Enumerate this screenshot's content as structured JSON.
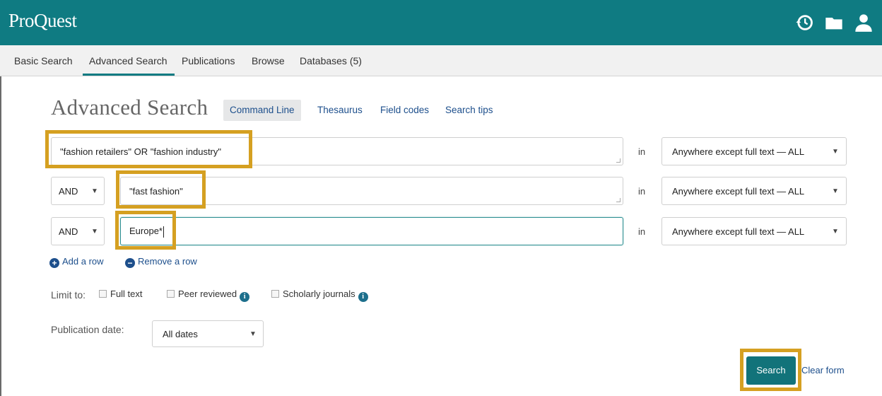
{
  "app": {
    "logo": "ProQuest"
  },
  "header_icons": [
    "history-icon",
    "folder-icon",
    "user-icon"
  ],
  "nav": {
    "tabs": [
      {
        "label": "Basic Search"
      },
      {
        "label": "Advanced Search",
        "active": true
      },
      {
        "label": "Publications"
      },
      {
        "label": "Browse"
      },
      {
        "label": "Databases (5)"
      }
    ]
  },
  "page": {
    "title": "Advanced Search",
    "command_line": "Command Line",
    "links": [
      "Thesaurus",
      "Field codes",
      "Search tips"
    ]
  },
  "rows": [
    {
      "operator": null,
      "query": "\"fashion retailers\" OR \"fashion industry\"",
      "in_label": "in",
      "field": "Anywhere except full text — ALL"
    },
    {
      "operator": "AND",
      "query": "\"fast fashion\"",
      "in_label": "in",
      "field": "Anywhere except full text — ALL"
    },
    {
      "operator": "AND",
      "query": "Europe*",
      "in_label": "in",
      "field": "Anywhere except full text — ALL",
      "focused": true
    }
  ],
  "row_actions": {
    "add": "Add a row",
    "remove": "Remove a row"
  },
  "limit": {
    "label": "Limit to:",
    "options": [
      {
        "label": "Full text",
        "checked": false,
        "info": false
      },
      {
        "label": "Peer reviewed",
        "checked": false,
        "info": true
      },
      {
        "label": "Scholarly journals",
        "checked": false,
        "info": true
      }
    ]
  },
  "publication_date": {
    "label": "Publication date:",
    "value": "All dates"
  },
  "buttons": {
    "search": "Search",
    "clear": "Clear form"
  },
  "colors": {
    "brand": "#0f7b82",
    "link": "#1d4f8c",
    "highlight": "#d5a021"
  }
}
